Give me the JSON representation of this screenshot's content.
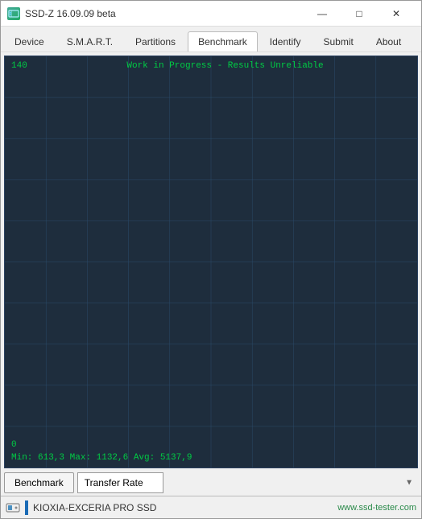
{
  "window": {
    "title": "SSD-Z 16.09.09 beta",
    "icon": "SSD"
  },
  "titlebar": {
    "minimize_label": "—",
    "maximize_label": "□",
    "close_label": "✕"
  },
  "menu": {
    "tabs": [
      {
        "id": "device",
        "label": "Device",
        "active": false
      },
      {
        "id": "smart",
        "label": "S.M.A.R.T.",
        "active": false
      },
      {
        "id": "partitions",
        "label": "Partitions",
        "active": false
      },
      {
        "id": "benchmark",
        "label": "Benchmark",
        "active": true
      },
      {
        "id": "identify",
        "label": "Identify",
        "active": false
      },
      {
        "id": "submit",
        "label": "Submit",
        "active": false
      },
      {
        "id": "about",
        "label": "About",
        "active": false
      }
    ]
  },
  "chart": {
    "y_max": "140",
    "y_min": "0",
    "warning_text": "Work in Progress - Results Unreliable",
    "stats_text": "Min: 613,3  Max: 1132,6  Avg: 5137,9",
    "grid_color": "#2a4a6a",
    "bg_color": "#1e2d3d"
  },
  "controls": {
    "benchmark_button_label": "Benchmark",
    "dropdown_value": "Transfer Rate",
    "dropdown_arrow": "▼"
  },
  "statusbar": {
    "drive_name": "KIOXIA-EXCERIA PRO SSD",
    "website": "www.ssd-tester.com"
  }
}
